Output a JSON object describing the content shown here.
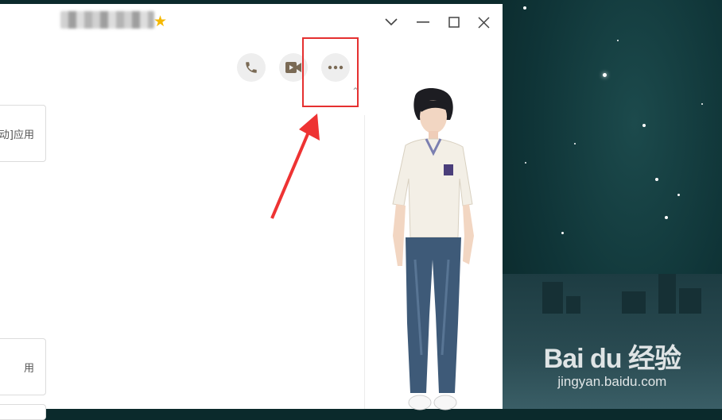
{
  "window": {
    "title_hidden": "",
    "controls": [
      "chevron-down",
      "minimize",
      "maximize",
      "close"
    ]
  },
  "actions": [
    {
      "id": "voice-call",
      "icon": "phone-icon"
    },
    {
      "id": "video-call",
      "icon": "video-icon"
    },
    {
      "id": "more",
      "icon": "more-dots-icon"
    }
  ],
  "cards": [
    {
      "label": "动]应用"
    },
    {
      "label": "用"
    }
  ],
  "watermark": {
    "logo": "Bai du 经验",
    "sub": "jingyan.baidu.com"
  },
  "colors": {
    "highlight": "#e53030",
    "star_badge": "#f5b800",
    "icon": "#7a6a55"
  }
}
